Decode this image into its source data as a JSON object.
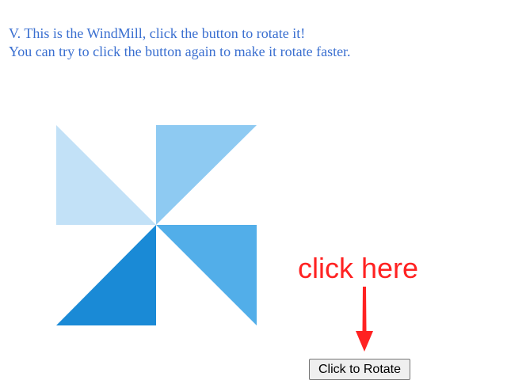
{
  "intro": {
    "line1": "V. This is the WindMill, click the button to rotate it!",
    "line2": "You can try to click the button again to make it rotate faster."
  },
  "hint": {
    "text": "click here",
    "color": "#ff2222"
  },
  "button": {
    "label": "Click to Rotate"
  },
  "windmill": {
    "icon": "pinwheel",
    "blade_colors": [
      "#c2e1f7",
      "#8ecaf2",
      "#52aee9",
      "#1a8ad6"
    ]
  },
  "colors": {
    "text": "#3a6fd0"
  }
}
